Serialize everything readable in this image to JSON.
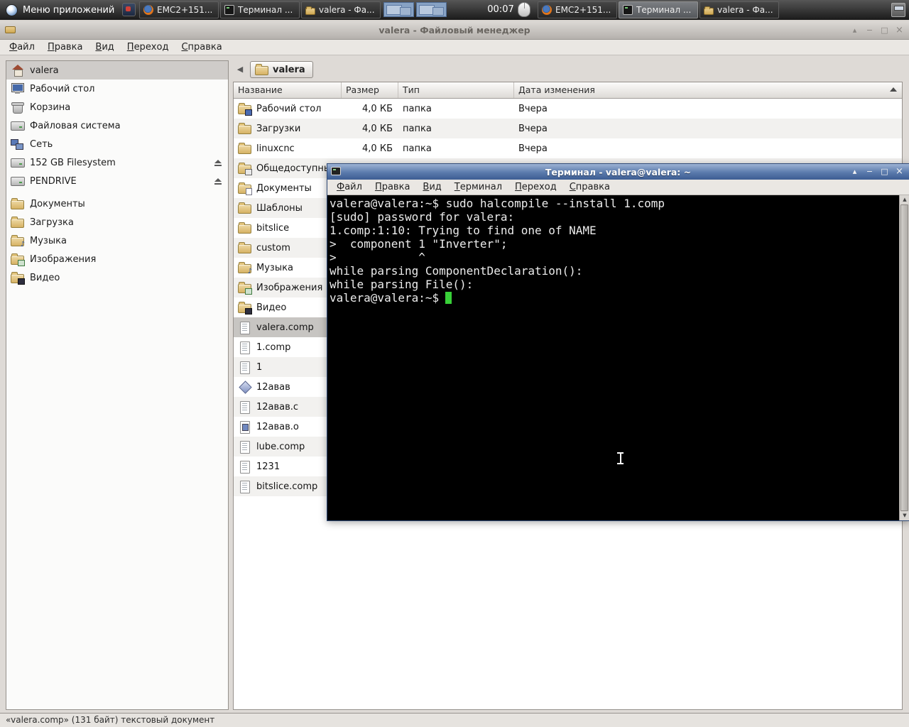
{
  "panel": {
    "menu_label": "Меню приложений",
    "clock": "00:07",
    "tasks_left": [
      {
        "label": "EMC2+151...",
        "icon": "firefox"
      },
      {
        "label": "Терминал ...",
        "icon": "terminal"
      },
      {
        "label": "valera - Фа...",
        "icon": "folder"
      }
    ],
    "tasks_right": [
      {
        "label": "EMC2+151...",
        "icon": "firefox"
      },
      {
        "label": "Терминал ...",
        "icon": "terminal",
        "active": true
      },
      {
        "label": "valera - Фа...",
        "icon": "folder"
      }
    ]
  },
  "filemanager": {
    "title": "valera - Файловый менеджер",
    "menu": [
      "Файл",
      "Правка",
      "Вид",
      "Переход",
      "Справка"
    ],
    "pathbar": {
      "current": "valera"
    },
    "sidebar": [
      {
        "label": "valera",
        "icon": "home",
        "selected": true
      },
      {
        "label": "Рабочий стол",
        "icon": "desktop"
      },
      {
        "label": "Корзина",
        "icon": "trash"
      },
      {
        "label": "Файловая система",
        "icon": "drive"
      },
      {
        "label": "Сеть",
        "icon": "network"
      },
      {
        "label": "152 GB Filesystem",
        "icon": "drive",
        "eject": true
      },
      {
        "label": "PENDRIVE",
        "icon": "drive",
        "eject": true
      },
      {
        "label": "Документы",
        "icon": "folder"
      },
      {
        "label": "Загрузка",
        "icon": "folder"
      },
      {
        "label": "Музыка",
        "icon": "folder-music"
      },
      {
        "label": "Изображения",
        "icon": "folder-images"
      },
      {
        "label": "Видео",
        "icon": "folder-video"
      }
    ],
    "list": {
      "columns": [
        "Название",
        "Размер",
        "Тип",
        "Дата изменения"
      ],
      "rows": [
        {
          "name": "Рабочий стол",
          "icon": "folder-desktop",
          "size": "4,0 КБ",
          "type": "папка",
          "date": "Вчера"
        },
        {
          "name": "Загрузки",
          "icon": "folder",
          "size": "4,0 КБ",
          "type": "папка",
          "date": "Вчера"
        },
        {
          "name": "linuxcnc",
          "icon": "folder",
          "size": "4,0 КБ",
          "type": "папка",
          "date": "Вчера"
        },
        {
          "name": "Общедоступные",
          "icon": "folder-public"
        },
        {
          "name": "Документы",
          "icon": "folder-docs"
        },
        {
          "name": "Шаблоны",
          "icon": "folder"
        },
        {
          "name": "bitslice",
          "icon": "folder"
        },
        {
          "name": "custom",
          "icon": "folder"
        },
        {
          "name": "Музыка",
          "icon": "folder-music"
        },
        {
          "name": "Изображения",
          "icon": "folder-images"
        },
        {
          "name": "Видео",
          "icon": "folder-video"
        },
        {
          "name": "valera.comp",
          "icon": "textfile",
          "selected": true
        },
        {
          "name": "1.comp",
          "icon": "textfile"
        },
        {
          "name": "1",
          "icon": "textfile"
        },
        {
          "name": "12авав",
          "icon": "diamond"
        },
        {
          "name": "12авав.c",
          "icon": "textfile"
        },
        {
          "name": "12авав.o",
          "icon": "objectfile"
        },
        {
          "name": "lube.comp",
          "icon": "textfile"
        },
        {
          "name": "1231",
          "icon": "textfile"
        },
        {
          "name": "bitslice.comp",
          "icon": "textfile"
        }
      ]
    },
    "statusbar": "«valera.comp» (131 байт) текстовый документ"
  },
  "terminal": {
    "title": "Терминал - valera@valera: ~",
    "menu": [
      "Файл",
      "Правка",
      "Вид",
      "Терминал",
      "Переход",
      "Справка"
    ],
    "lines": [
      "valera@valera:~$ sudo halcompile --install 1.comp",
      "[sudo] password for valera:",
      "1.comp:1:10: Trying to find one of NAME",
      ">  component 1 \"Inverter\";",
      ">            ^",
      "while parsing ComponentDeclaration():",
      "while parsing File():"
    ],
    "prompt": "valera@valera:~$"
  }
}
